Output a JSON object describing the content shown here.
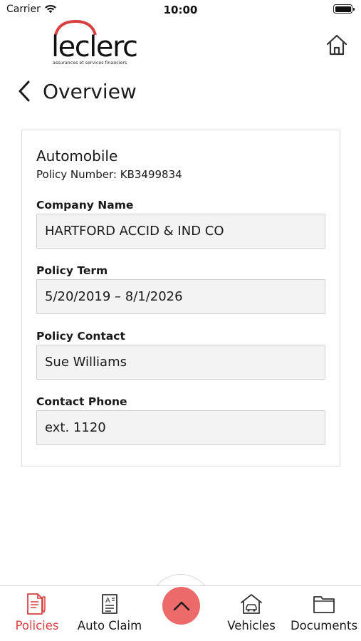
{
  "status_bar": {
    "carrier": "Carrier",
    "time": "10:00"
  },
  "header": {
    "logo_text": "leclerc",
    "logo_tagline": "assurances et services financiers",
    "title": "Overview"
  },
  "policy": {
    "type": "Automobile",
    "number_label": "Policy Number:",
    "number": "KB3499834",
    "fields": [
      {
        "label": "Company Name",
        "value": "HARTFORD ACCID & IND CO"
      },
      {
        "label": "Policy Term",
        "value": "5/20/2019 – 8/1/2026"
      },
      {
        "label": "Policy Contact",
        "value": "Sue Williams"
      },
      {
        "label": "Contact Phone",
        "value": "ext. 1120"
      }
    ]
  },
  "tab_bar": {
    "items": [
      {
        "label": "Policies",
        "icon": "policies-icon",
        "active": true
      },
      {
        "label": "Auto Claim",
        "icon": "auto-claim-icon",
        "active": false
      },
      {
        "label": "Vehicles",
        "icon": "vehicles-icon",
        "active": false
      },
      {
        "label": "Documents",
        "icon": "documents-icon",
        "active": false
      }
    ],
    "fab_icon": "chevron-up-icon"
  },
  "colors": {
    "brand_red": "#d8403f",
    "fab_red": "#ec6a6a",
    "field_bg": "#f3f3f3"
  }
}
